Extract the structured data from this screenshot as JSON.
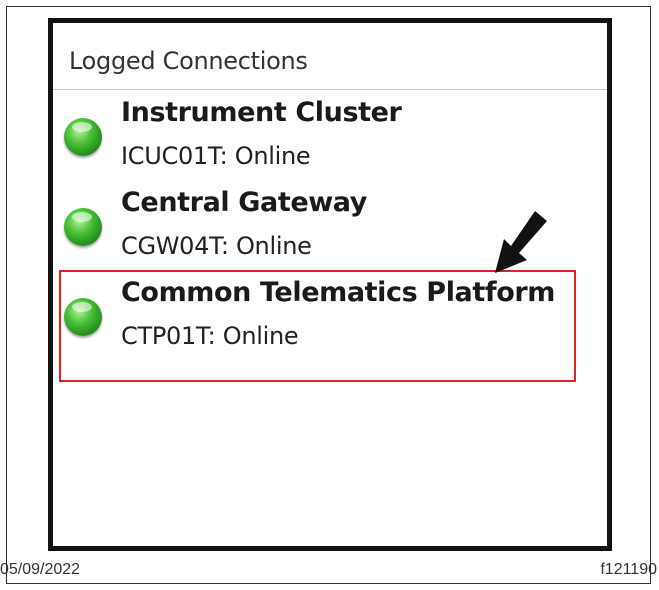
{
  "panel": {
    "title": "Logged Connections"
  },
  "connections": [
    {
      "name": "Instrument Cluster",
      "status": "ICUC01T: Online",
      "status_color": "#2ea82a"
    },
    {
      "name": "Central Gateway",
      "status": "CGW04T: Online",
      "status_color": "#2ea82a"
    },
    {
      "name": "Common Telematics Platform",
      "status": "CTP01T: Online",
      "status_color": "#2ea82a"
    }
  ],
  "highlight": {
    "color": "#e02020",
    "target": "Common Telematics Platform"
  },
  "arrow": {
    "icon": "arrow-down-left-icon",
    "color": "#111111"
  },
  "footer": {
    "date": "05/09/2022",
    "figure_id": "f121190"
  }
}
